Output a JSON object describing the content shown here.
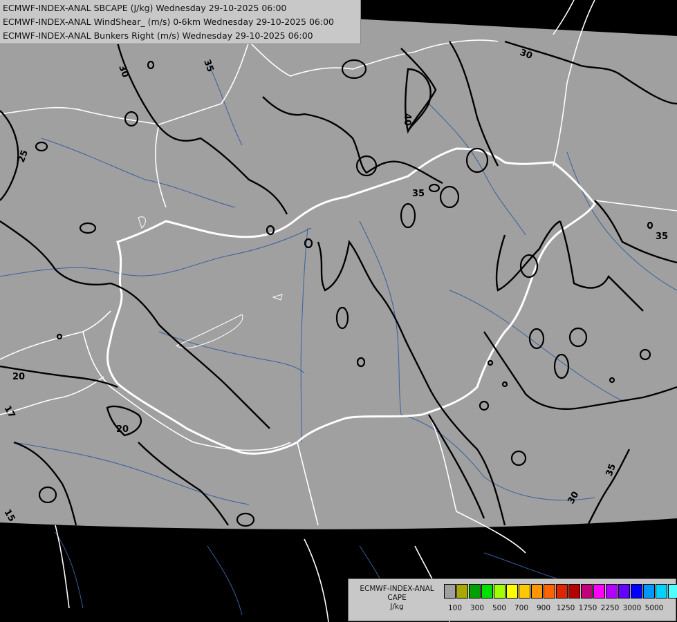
{
  "titles": [
    "ECMWF-INDEX-ANAL SBCAPE (J/kg) Wednesday 29-10-2025 06:00",
    "ECMWF-INDEX-ANAL WindShear_ (m/s) 0-6km Wednesday 29-10-2025 06:00",
    "ECMWF-INDEX-ANAL Bunkers Right (m/s) Wednesday 29-10-2025 06:00"
  ],
  "colors": {
    "background": "#000000",
    "data_area": "#a0a0a0",
    "borders": "#ffffff",
    "rivers": "#3a5f9e",
    "contours": "#000000"
  },
  "contour_labels": [
    "30",
    "35",
    "25",
    "40",
    "35",
    "30",
    "35",
    "20",
    "17",
    "20",
    "15",
    "35",
    "30"
  ],
  "legend": {
    "title_lines": [
      "ECMWF-INDEX-ANAL",
      "CAPE",
      "J/kg"
    ],
    "swatch_colors": [
      "#a0a0a0",
      "#a8a800",
      "#00a000",
      "#00e000",
      "#a0ff00",
      "#ffff00",
      "#ffc800",
      "#ff9600",
      "#ff6400",
      "#dc2800",
      "#b40000",
      "#c00078",
      "#ff00ff",
      "#b400ff",
      "#6400ff",
      "#0000ff",
      "#0096ff",
      "#00d2ff",
      "#50ffff",
      "#ffffff"
    ],
    "tick_labels": [
      "100",
      "300",
      "500",
      "700",
      "900",
      "1250",
      "1750",
      "2250",
      "3000",
      "5000"
    ]
  }
}
